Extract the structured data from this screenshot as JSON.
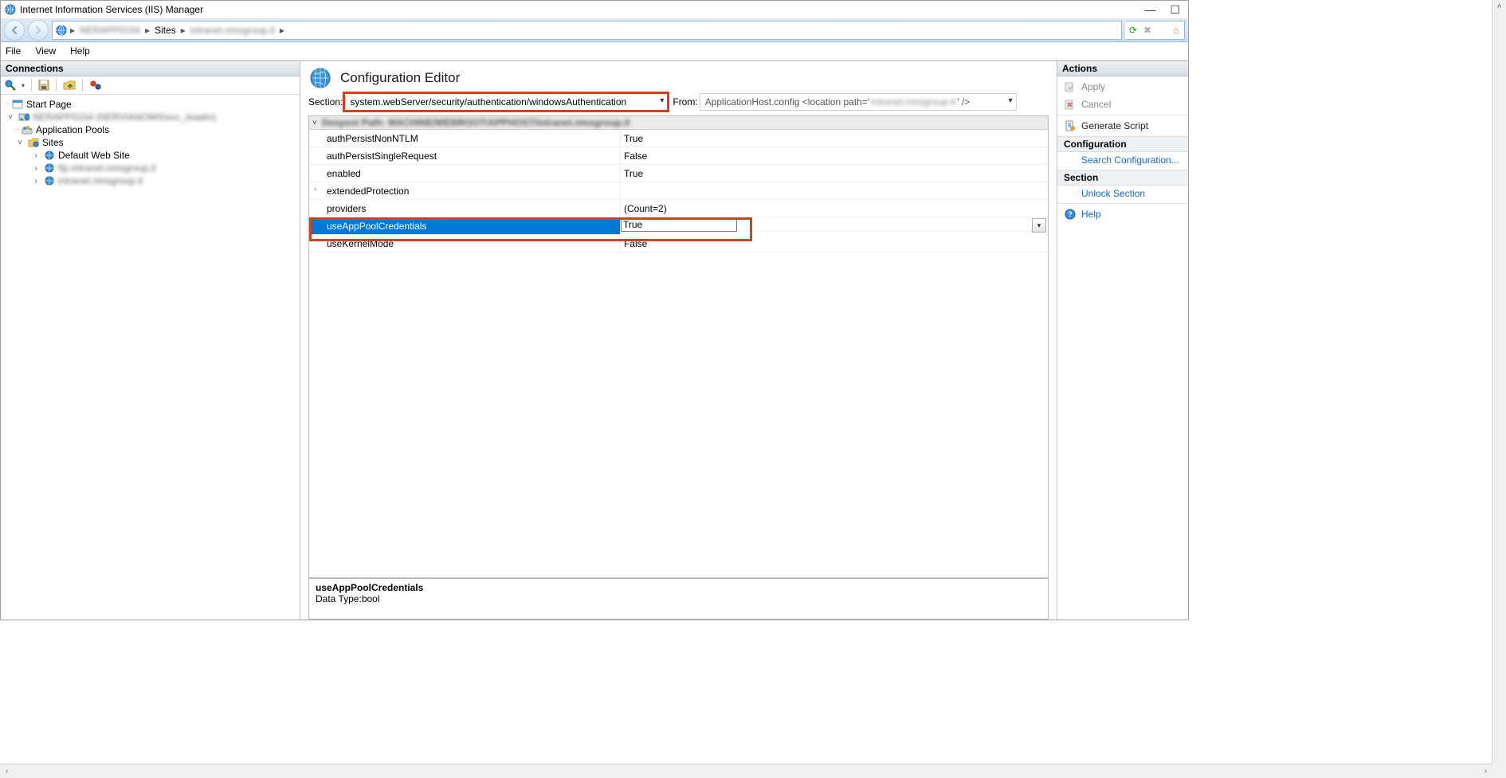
{
  "titlebar": {
    "title": "Internet Information Services (IIS) Manager"
  },
  "breadcrumb": {
    "server": "NERAPP0154",
    "sites_label": "Sites",
    "site": "intranet.nmsgroup.it"
  },
  "menubar": {
    "file": "File",
    "view": "View",
    "help": "Help"
  },
  "connections": {
    "header": "Connections",
    "start_page": "Start Page",
    "server_node": "NERAPP0154 (NERVIANOMS\\svc_iisadm)",
    "app_pools": "Application Pools",
    "sites": "Sites",
    "site_default": "Default Web Site",
    "site_ftp": "ftp.intranet.nmsgroup.it",
    "site_intranet": "intranet.nmsgroup.it"
  },
  "editor": {
    "title": "Configuration Editor",
    "section_label": "Section:",
    "section_value": "system.webServer/security/authentication/windowsAuthentication",
    "from_label": "From:",
    "from_prefix": "ApplicationHost.config <location path='",
    "from_blur": "intranet.nmsgroup.it",
    "from_suffix": "' />",
    "group_header": "Deepest Path: MACHINE/WEBROOT/APPHOST/intranet.nmsgroup.it",
    "rows": [
      {
        "key": "authPersistNonNTLM",
        "val": "True"
      },
      {
        "key": "authPersistSingleRequest",
        "val": "False"
      },
      {
        "key": "enabled",
        "val": "True"
      },
      {
        "key": "extendedProtection",
        "val": "",
        "expandable": true
      },
      {
        "key": "providers",
        "val": "(Count=2)"
      },
      {
        "key": "useAppPoolCredentials",
        "val": "True",
        "selected": true,
        "editing": true,
        "highlight": true
      },
      {
        "key": "useKernelMode",
        "val": "False"
      }
    ],
    "details": {
      "name": "useAppPoolCredentials",
      "type_line": "Data Type:bool"
    }
  },
  "actions": {
    "header": "Actions",
    "apply": "Apply",
    "cancel": "Cancel",
    "generate_script": "Generate Script",
    "config_header": "Configuration",
    "search_config": "Search Configuration...",
    "section_header": "Section",
    "unlock_section": "Unlock Section",
    "help": "Help"
  }
}
